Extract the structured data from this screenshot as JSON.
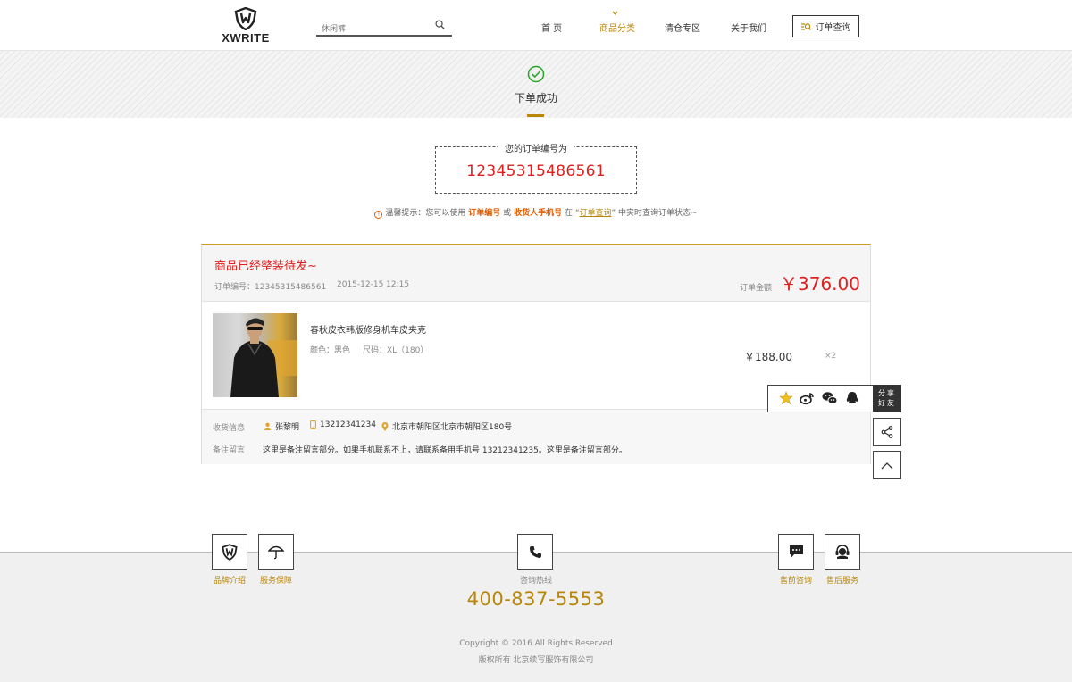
{
  "header": {
    "logo_text": "XWRITE",
    "search_placeholder": "休闲裤",
    "nav": [
      {
        "label": "首 页"
      },
      {
        "label": "商品分类"
      },
      {
        "label": "清仓专区"
      },
      {
        "label": "关于我们"
      }
    ],
    "order_query_label": "订单查询",
    "accent_color": "#b8860b"
  },
  "success": {
    "title": "下单成功",
    "order_label": "您的订单编号为",
    "order_number": "12345315486561",
    "tip_prefix": "温馨提示：您可以使用",
    "tip_order_no": "订单编号",
    "tip_or": "或",
    "tip_phone": "收货人手机号",
    "tip_in": "在",
    "tip_link": "订单查询",
    "tip_suffix": "中实时查询订单状态~"
  },
  "order": {
    "status": "商品已经整装待发~",
    "number_line": "订单编号：12345315486561",
    "time": "2015-12-15 12:15",
    "amount_label": "订单金额",
    "amount": "￥376.00",
    "product": {
      "name": "春秋皮衣韩版修身机车皮夹克",
      "color": "颜色：黑色",
      "size": "尺码：XL（180）",
      "price": "￥188.00",
      "qty": "×2"
    },
    "receiver_label": "收货信息",
    "receiver_name": "张黎明",
    "receiver_phone": "13212341234",
    "receiver_address": "北京市朝阳区北京市朝阳区180号",
    "remark_label": "备注留言",
    "remark": "这里是备注留言部分。如果手机联系不上，请联系备用手机号 13212341235。这里是备注留言部分。"
  },
  "share": {
    "label_line1": "分享",
    "label_line2": "好友"
  },
  "footer": {
    "brand_intro": "品牌介绍",
    "service_guarantee": "服务保障",
    "hotline_label": "咨询热线",
    "hotline": "400-837-5553",
    "presale": "售前咨询",
    "aftersale": "售后服务",
    "copyright": "Copyright © 2016 All Rights Reserved",
    "company": "版权所有 北京续写服饰有限公司"
  }
}
